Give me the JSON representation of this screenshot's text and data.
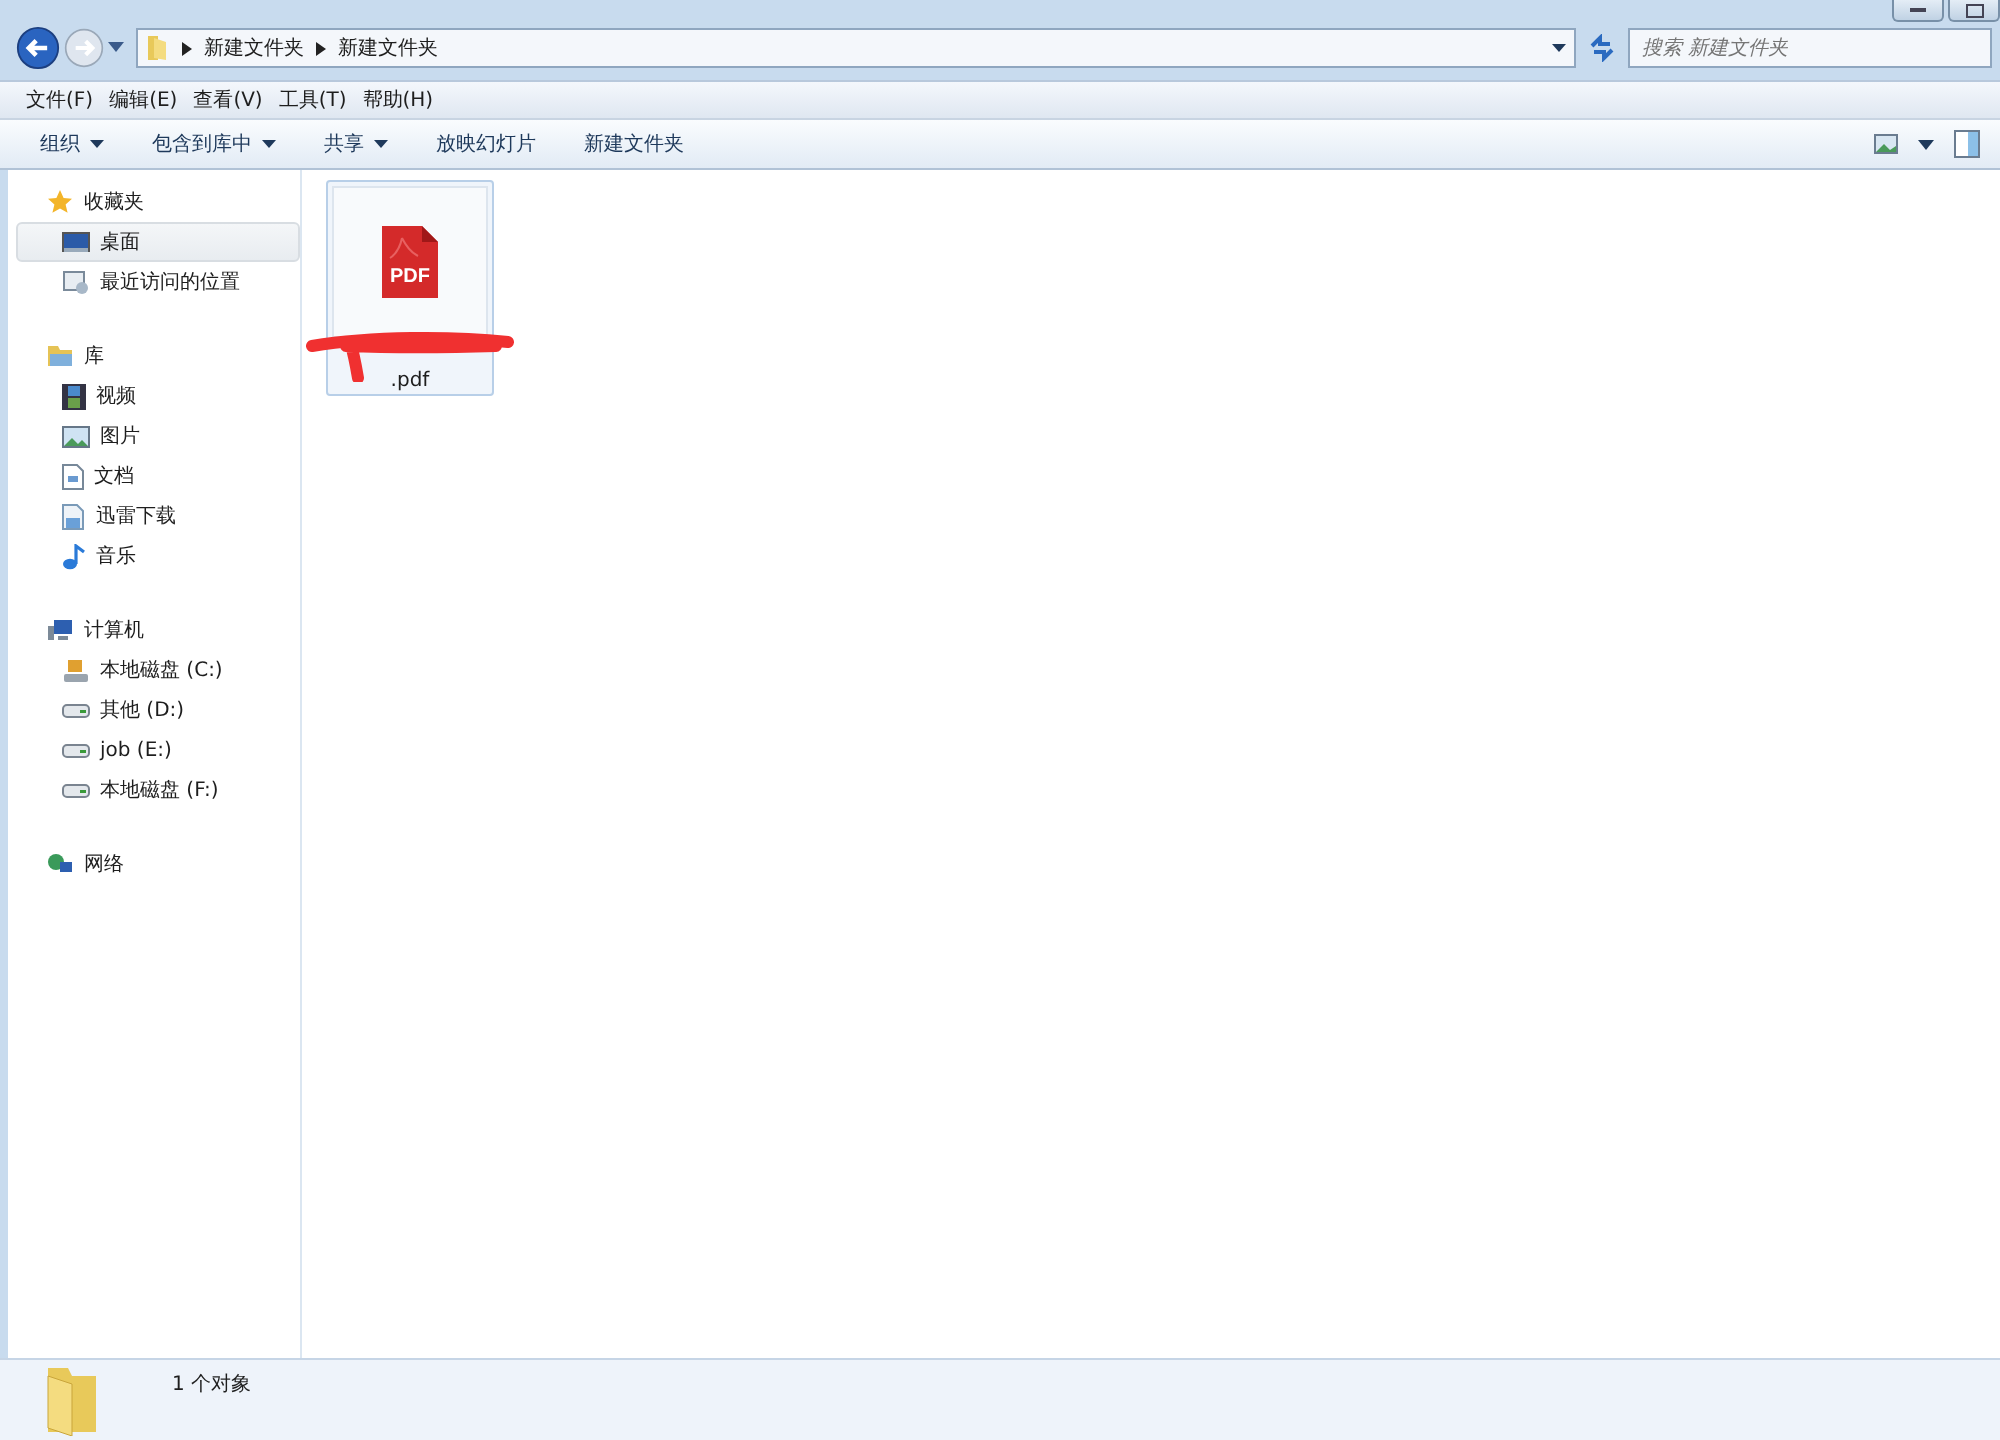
{
  "address_bar": {
    "path": [
      "新建文件夹",
      "新建文件夹"
    ]
  },
  "search": {
    "placeholder": "搜索 新建文件夹"
  },
  "menu_bar": [
    "文件(F)",
    "编辑(E)",
    "查看(V)",
    "工具(T)",
    "帮助(H)"
  ],
  "toolbar": [
    {
      "label": "组织",
      "dropdown": true
    },
    {
      "label": "包含到库中",
      "dropdown": true
    },
    {
      "label": "共享",
      "dropdown": true
    },
    {
      "label": "放映幻灯片",
      "dropdown": false
    },
    {
      "label": "新建文件夹",
      "dropdown": false
    }
  ],
  "sidebar": {
    "items": [
      {
        "label": "收藏夹",
        "selected": false,
        "children": [
          {
            "label": "桌面",
            "selected": true
          },
          {
            "label": "最近访问的位置",
            "selected": false
          }
        ]
      },
      {
        "label": "库",
        "selected": false,
        "children": [
          {
            "label": "视频",
            "selected": false
          },
          {
            "label": "图片",
            "selected": false
          },
          {
            "label": "文档",
            "selected": false
          },
          {
            "label": "迅雷下载",
            "selected": false
          },
          {
            "label": "音乐",
            "selected": false
          }
        ]
      },
      {
        "label": "计算机",
        "selected": false,
        "children": [
          {
            "label": "本地磁盘 (C:)",
            "selected": false
          },
          {
            "label": "其他 (D:)",
            "selected": false
          },
          {
            "label": "job (E:)",
            "selected": false
          },
          {
            "label": "本地磁盘 (F:)",
            "selected": false
          }
        ]
      },
      {
        "label": "网络",
        "selected": false
      }
    ]
  },
  "files": [
    {
      "name": ".pdf",
      "icon_label": "PDF",
      "selected": true,
      "redacted": true
    }
  ],
  "status_bar": {
    "text": "1 个对象"
  }
}
